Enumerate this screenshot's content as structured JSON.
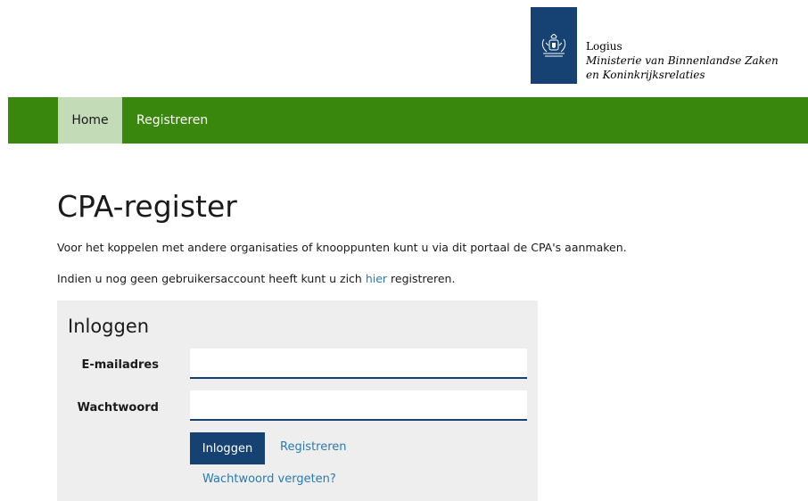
{
  "header": {
    "logo_org": "Logius",
    "logo_ministry": "Ministerie van Binnenlandse Zaken en Koninkrijksrelaties",
    "emblem_icon": "dutch-coat-of-arms-icon"
  },
  "nav": {
    "items": [
      {
        "label": "Home",
        "active": true
      },
      {
        "label": "Registreren",
        "active": false
      }
    ]
  },
  "main": {
    "title": "CPA-register",
    "intro_line1": "Voor het koppelen met andere organisaties of knooppunten kunt u via dit portaal de CPA's aanmaken.",
    "intro_line2_before": "Indien u nog geen gebruikersaccount heeft kunt u zich ",
    "intro_line2_link": "hier",
    "intro_line2_after": " registreren."
  },
  "login": {
    "heading": "Inloggen",
    "email_label": "E-mailadres",
    "email_value": "",
    "password_label": "Wachtwoord",
    "password_value": "",
    "submit_label": "Inloggen",
    "register_link": "Registreren",
    "forgot_link": "Wachtwoord vergeten?"
  },
  "colors": {
    "nav_green": "#39870c",
    "nav_active": "#c3dbb6",
    "brand_blue": "#154273",
    "link_blue": "#2a7ab0",
    "panel_grey": "#eeeeee"
  }
}
